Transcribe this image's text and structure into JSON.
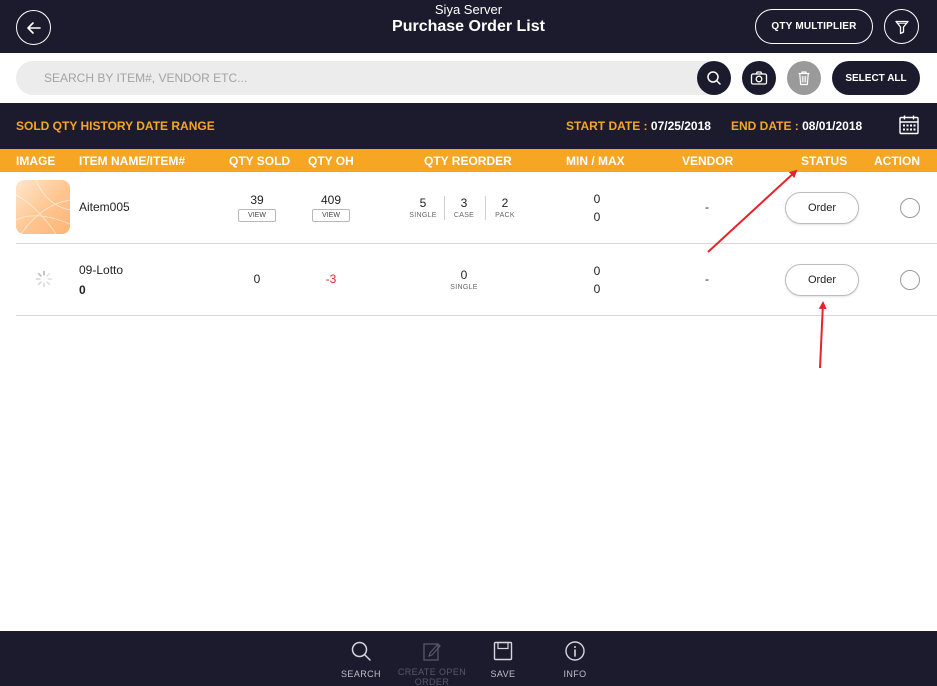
{
  "header": {
    "subtitle": "Siya Server",
    "title": "Purchase Order List",
    "qty_multiplier_label": "QTY MULTIPLIER"
  },
  "search": {
    "placeholder": "SEARCH BY ITEM#, VENDOR ETC...",
    "select_all_label": "SELECT ALL"
  },
  "date_range": {
    "label": "SOLD QTY HISTORY DATE RANGE",
    "start_label": "START DATE : ",
    "start_value": "07/25/2018",
    "end_label": "END DATE : ",
    "end_value": "08/01/2018"
  },
  "columns": [
    "IMAGE",
    "ITEM NAME/ITEM#",
    "QTY SOLD",
    "QTY OH",
    "QTY REORDER",
    "MIN / MAX",
    "VENDOR",
    "STATUS",
    "ACTION"
  ],
  "rows": [
    {
      "name": "Aitem005",
      "item_no": "",
      "qty_sold": "39",
      "qty_sold_view": "VIEW",
      "qty_oh": "409",
      "qty_oh_view": "VIEW",
      "reorder": [
        {
          "value": "5",
          "label": "SINGLE"
        },
        {
          "value": "3",
          "label": "CASE"
        },
        {
          "value": "2",
          "label": "PACK"
        }
      ],
      "min": "0",
      "max": "0",
      "vendor": "-",
      "status": "Order"
    },
    {
      "name": "09-Lotto",
      "item_no": "0",
      "qty_sold": "0",
      "qty_oh": "-3",
      "reorder": [
        {
          "value": "0",
          "label": "SINGLE"
        }
      ],
      "min": "0",
      "max": "0",
      "vendor": "-",
      "status": "Order"
    }
  ],
  "footer": {
    "search": "SEARCH",
    "create_open_order": "CREATE OPEN ORDER",
    "save": "SAVE",
    "info": "INFO"
  },
  "colors": {
    "navy": "#1c1b2e",
    "accent": "#f6a623",
    "negative": "#e8242b",
    "annotation_arrow": "#e8242b"
  }
}
